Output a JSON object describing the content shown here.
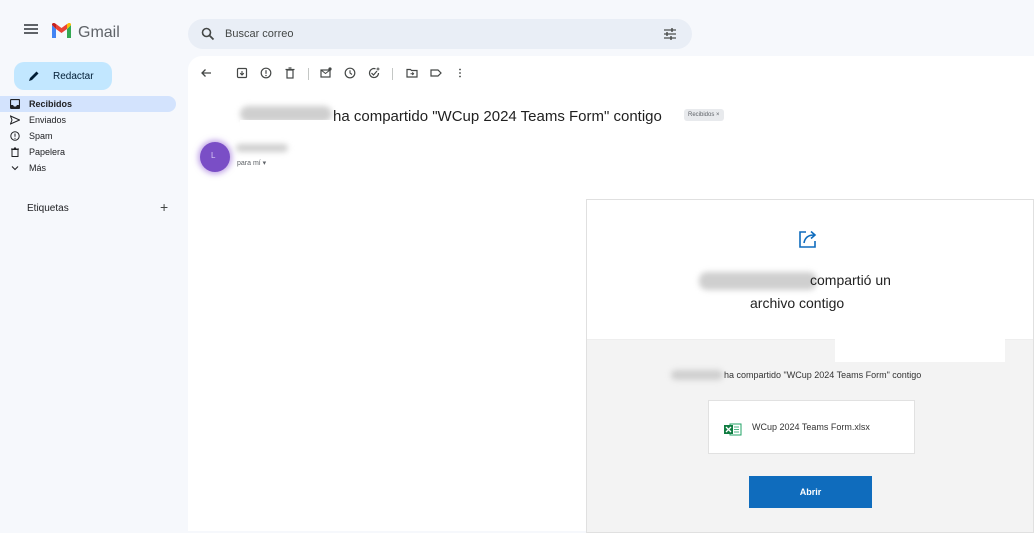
{
  "app": {
    "name": "Gmail",
    "icons": {
      "menu": "hamburger-icon",
      "logo": "gmail-m-logo"
    }
  },
  "search": {
    "placeholder": "Buscar correo",
    "icons": {
      "search": "search-icon",
      "filters": "tune-icon"
    }
  },
  "compose": {
    "label": "Redactar",
    "icon": "pencil-icon"
  },
  "sidebar": {
    "items": [
      {
        "label": "Recibidos",
        "icon": "inbox-icon",
        "active": true
      },
      {
        "label": "Enviados",
        "icon": "send-icon",
        "active": false
      },
      {
        "label": "Spam",
        "icon": "spam-icon",
        "active": false
      },
      {
        "label": "Papelera",
        "icon": "trash-icon",
        "active": false
      },
      {
        "label": "Más",
        "icon": "chevron-down-icon",
        "active": false
      }
    ],
    "labels_header": "Etiquetas",
    "add_label_icon": "plus-icon"
  },
  "toolbar": {
    "icons": [
      "back-icon",
      "archive-icon",
      "report-icon",
      "delete-icon",
      "mark-unread-icon",
      "snooze-icon",
      "add-task-icon",
      "move-to-icon",
      "label-icon",
      "more-vert-icon"
    ]
  },
  "message": {
    "subject": "ha compartido \"WCup 2024 Teams Form\" contigo",
    "inbox_chip": "Recibidos ×",
    "avatar_initial": "L",
    "recipient": "para mí ▾"
  },
  "share_card": {
    "icon": "share-arrow-icon",
    "title_line1": "compartió un",
    "title_line2": "archivo contigo",
    "description": "ha compartido \"WCup 2024 Teams Form\" contigo",
    "file_name": "WCup 2024 Teams Form.xlsx",
    "file_icon": "excel-file-icon",
    "open_button": "Abrir",
    "accent_color": "#0f6cbd"
  }
}
